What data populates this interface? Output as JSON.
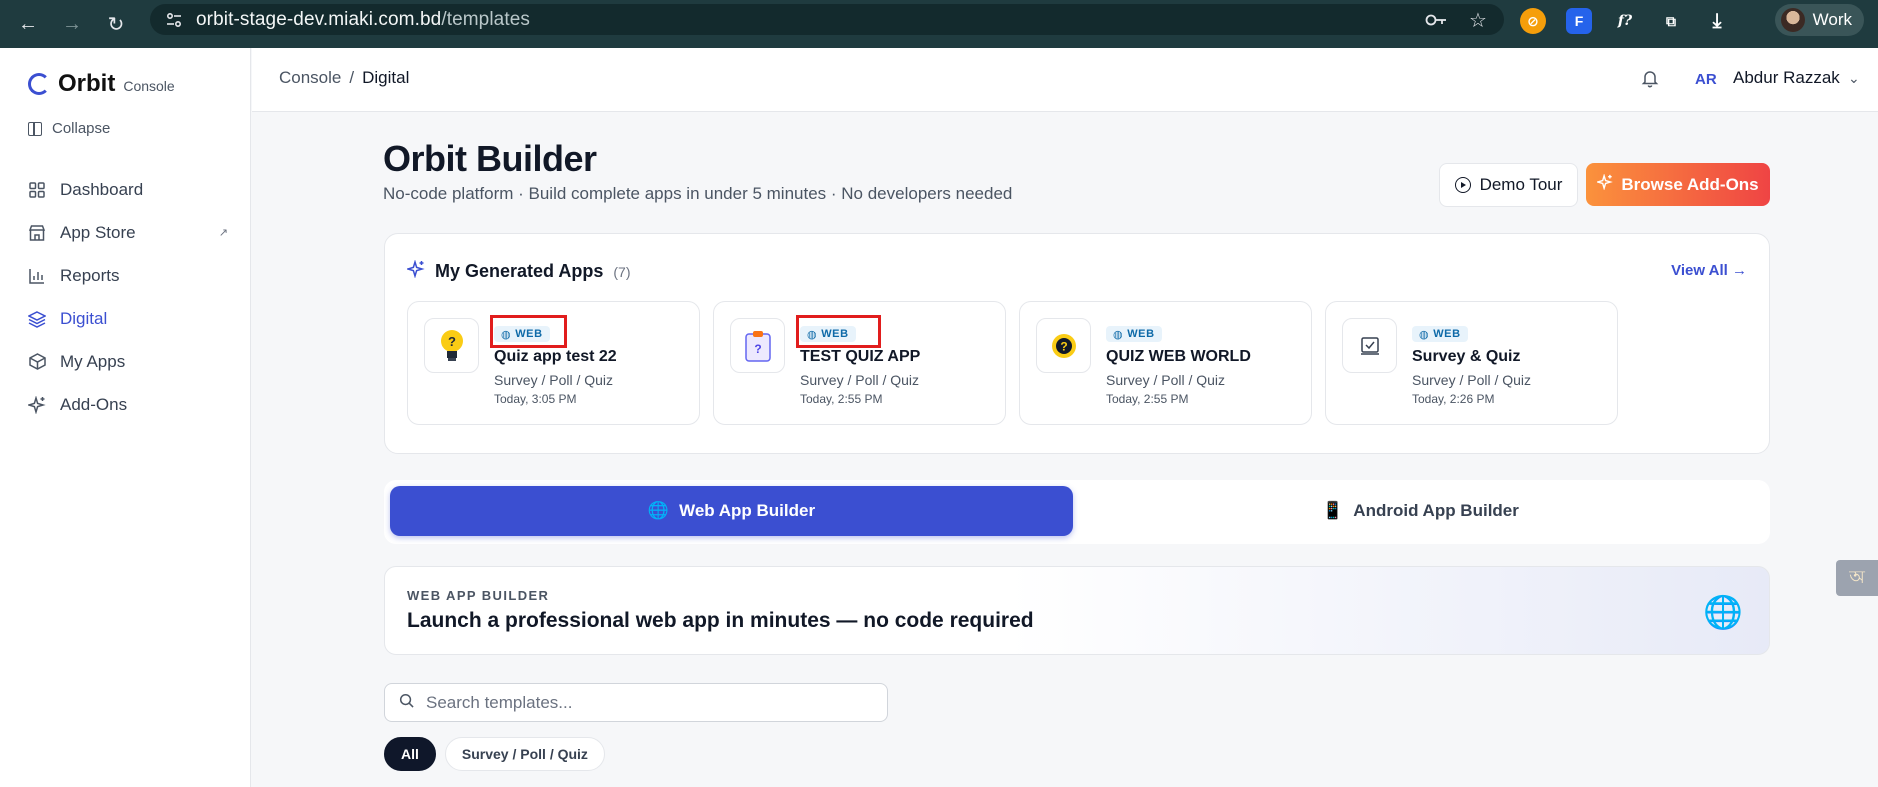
{
  "browser": {
    "url_host": "orbit-stage-dev.miaki.com.bd",
    "url_path": "/templates",
    "profile_label": "Work"
  },
  "sidebar": {
    "brand_name": "Orbit",
    "brand_sub": "Console",
    "collapse_label": "Collapse",
    "items": [
      {
        "label": "Dashboard",
        "icon": "grid-icon"
      },
      {
        "label": "App Store",
        "icon": "store-icon"
      },
      {
        "label": "Reports",
        "icon": "bar-chart-icon"
      },
      {
        "label": "Digital",
        "icon": "layers-icon",
        "active": true
      },
      {
        "label": "My Apps",
        "icon": "box-icon"
      },
      {
        "label": "Add-Ons",
        "icon": "sparkles-icon"
      }
    ]
  },
  "header": {
    "breadcrumb_root": "Console",
    "breadcrumb_sep": "/",
    "breadcrumb_current": "Digital",
    "user_initials": "AR",
    "user_name": "Abdur Razzak"
  },
  "page": {
    "title": "Orbit Builder",
    "subtitle": "No-code platform · Build complete apps in under 5 minutes · No developers needed",
    "demo_button": "Demo Tour",
    "addons_button": "Browse Add-Ons"
  },
  "generated_apps": {
    "title": "My Generated Apps",
    "count": "(7)",
    "view_all": "View All →",
    "apps": [
      {
        "badge": "WEB",
        "name": "Quiz app test 22",
        "category": "Survey / Poll / Quiz",
        "time": "Today, 3:05 PM",
        "icon": "lightbulb-icon",
        "highlighted": true
      },
      {
        "badge": "WEB",
        "name": "TEST QUIZ APP",
        "category": "Survey / Poll / Quiz",
        "time": "Today, 2:55 PM",
        "icon": "clipboard-icon",
        "highlighted": true
      },
      {
        "badge": "WEB",
        "name": "QUIZ WEB WORLD",
        "category": "Survey / Poll / Quiz",
        "time": "Today, 2:55 PM",
        "icon": "question-icon",
        "highlighted": false
      },
      {
        "badge": "WEB",
        "name": "Survey & Quiz",
        "category": "Survey / Poll / Quiz",
        "time": "Today, 2:26 PM",
        "icon": "check-square-icon",
        "highlighted": false
      }
    ]
  },
  "builder_tabs": {
    "web": "Web App Builder",
    "android": "Android App Builder"
  },
  "hero": {
    "eyebrow": "WEB APP BUILDER",
    "headline": "Launch a professional web app in minutes — no code required"
  },
  "search": {
    "placeholder": "Search templates..."
  },
  "filters": [
    "All",
    "Survey / Poll / Quiz"
  ],
  "colors": {
    "accent": "#3b4fd1",
    "addons_gradient_start": "#fb923c",
    "addons_gradient_end": "#ef4444",
    "highlight_box": "#e11d1d"
  }
}
